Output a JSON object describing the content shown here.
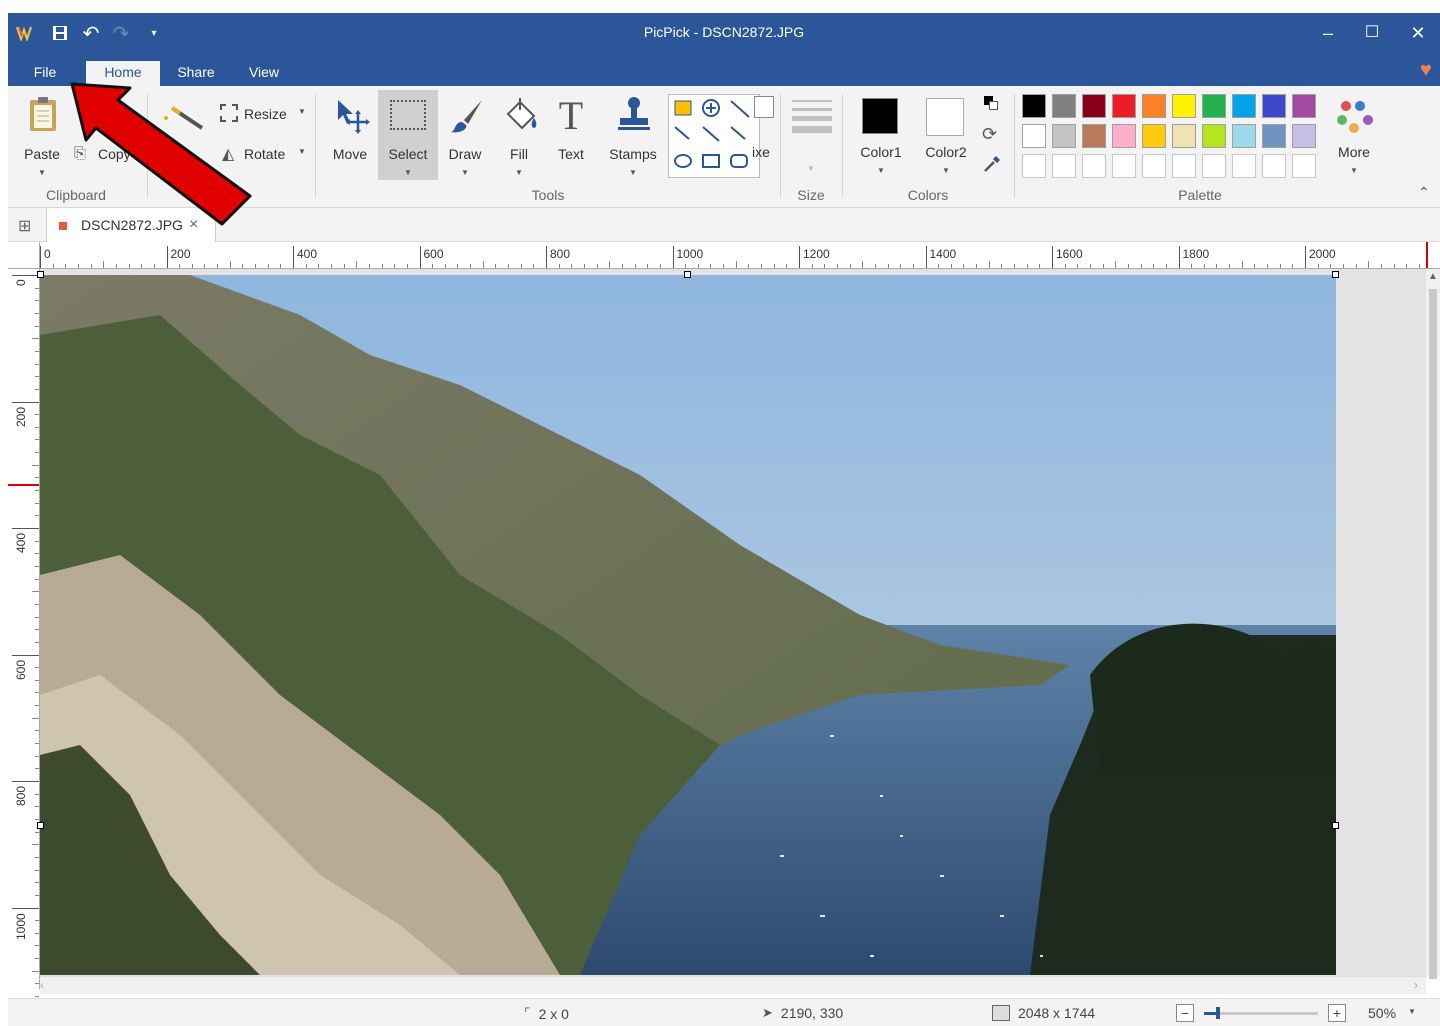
{
  "window": {
    "title": "PicPick - DSCN2872.JPG"
  },
  "menu_tabs": [
    "File",
    "Home",
    "Share",
    "View"
  ],
  "ribbon": {
    "clipboard": {
      "paste": "Paste",
      "copy": "Copy",
      "group": "Clipboard"
    },
    "image": {
      "resize": "Resize",
      "rotate": "Rotate"
    },
    "tools": {
      "move": "Move",
      "select": "Select",
      "draw": "Draw",
      "fill": "Fill",
      "text": "Text",
      "stamps": "Stamps",
      "pixelate_partial": "ixe",
      "group": "Tools"
    },
    "size": {
      "group": "Size"
    },
    "colors": {
      "color1": "Color1",
      "color2": "Color2",
      "group": "Colors"
    },
    "palette": {
      "group": "Palette",
      "more": "More",
      "row1": [
        "#000000",
        "#7f7f7f",
        "#880015",
        "#ed1c24",
        "#ff7f27",
        "#fff200",
        "#22b14c",
        "#00a2e8",
        "#3f48cc",
        "#a349a4"
      ],
      "row2": [
        "#ffffff",
        "#c3c3c3",
        "#b97a57",
        "#ffaec9",
        "#ffc90e",
        "#efe4b0",
        "#b5e61d",
        "#99d9ea",
        "#7092be",
        "#c8bfe7"
      ],
      "row3": [
        "#ffffff",
        "#ffffff",
        "#ffffff",
        "#ffffff",
        "#ffffff",
        "#ffffff",
        "#ffffff",
        "#ffffff",
        "#ffffff",
        "#ffffff"
      ]
    }
  },
  "document_tab": {
    "name": "DSCN2872.JPG",
    "close": "×"
  },
  "ruler": {
    "h_labels": [
      "0",
      "200",
      "400",
      "600",
      "800",
      "1000",
      "1200",
      "1400",
      "1600",
      "1800",
      "2000"
    ],
    "v_labels": [
      "0",
      "200",
      "400",
      "600",
      "800",
      "1000"
    ]
  },
  "statusbar": {
    "selection": "2 x 0",
    "cursor": "2190, 330",
    "image_size": "2048 x 1744",
    "zoom": "50%",
    "zoom_level": 0.5
  },
  "accent_color": "#2b579a",
  "annotation_color": "#e00000"
}
